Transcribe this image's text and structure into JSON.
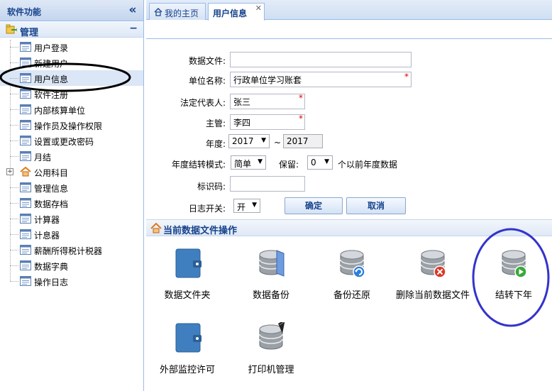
{
  "sidebar": {
    "title": "软件功能",
    "collapse_glyph": "«",
    "group": {
      "title": "管理",
      "collapse_glyph": "−"
    },
    "items": [
      {
        "label": "用户登录",
        "icon": "form-icon"
      },
      {
        "label": "新建用户",
        "icon": "form-icon"
      },
      {
        "label": "用户信息",
        "icon": "form-icon",
        "selected": true
      },
      {
        "label": "软件注册",
        "icon": "form-icon"
      },
      {
        "label": "内部核算单位",
        "icon": "form-icon"
      },
      {
        "label": "操作员及操作权限",
        "icon": "form-icon"
      },
      {
        "label": "设置或更改密码",
        "icon": "form-icon"
      },
      {
        "label": "月结",
        "icon": "form-icon"
      },
      {
        "label": "公用科目",
        "icon": "home-icon",
        "expander": "+"
      },
      {
        "label": "管理信息",
        "icon": "form-icon"
      },
      {
        "label": "数据存档",
        "icon": "form-icon"
      },
      {
        "label": "计算器",
        "icon": "form-icon"
      },
      {
        "label": "计息器",
        "icon": "form-icon"
      },
      {
        "label": "薪酬所得税计税器",
        "icon": "form-icon"
      },
      {
        "label": "数据字典",
        "icon": "form-icon"
      },
      {
        "label": "操作日志",
        "icon": "form-icon"
      }
    ]
  },
  "tabs": [
    {
      "label": "我的主页",
      "icon": "home-icon"
    },
    {
      "label": "用户信息",
      "active": true,
      "close_glyph": "✕"
    }
  ],
  "form": {
    "data_file_label": "数据文件:",
    "data_file_value": "",
    "unit_name_label": "单位名称:",
    "unit_name_value": "行政单位学习账套",
    "legal_rep_label": "法定代表人:",
    "legal_rep_value": "张三",
    "supervisor_label": "主管:",
    "supervisor_value": "李四",
    "required_mark": "*",
    "year_label": "年度:",
    "year_from": "2017",
    "year_sep": "~",
    "year_to": "2017",
    "carry_mode_label": "年度结转模式:",
    "carry_mode_value": "简单",
    "keep_label": "保留:",
    "keep_value": "0",
    "keep_suffix": "个以前年度数据",
    "id_code_label": "标识码:",
    "id_code_value": "",
    "log_switch_label": "日志开关:",
    "log_switch_value": "开",
    "ok_button": "确定",
    "cancel_button": "取消"
  },
  "ops": {
    "title": "当前数据文件操作",
    "items": [
      {
        "label": "数据文件夹",
        "icon": "folder-icon"
      },
      {
        "label": "数据备份",
        "icon": "database-backup-icon"
      },
      {
        "label": "备份还原",
        "icon": "database-restore-icon"
      },
      {
        "label": "删除当前数据文件",
        "icon": "database-delete-icon"
      },
      {
        "label": "结转下年",
        "icon": "database-carry-forward-icon"
      },
      {
        "label": "外部监控许可",
        "icon": "folder-icon"
      },
      {
        "label": "打印机管理",
        "icon": "database-printer-icon"
      }
    ]
  },
  "colors": {
    "accent": "#15428b",
    "border": "#99bbe8",
    "required": "#dd0000",
    "annotation_black": "#000000",
    "annotation_blue": "#3333cc"
  }
}
